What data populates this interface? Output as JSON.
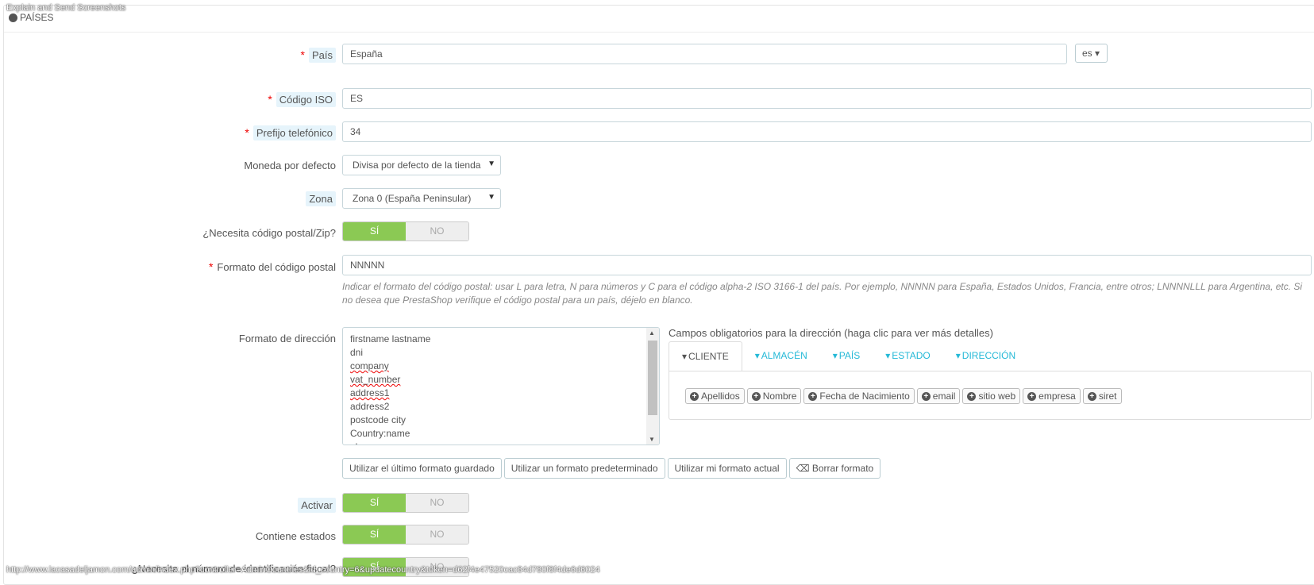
{
  "overlay_text": "Explain and Send Screenshots",
  "panel": {
    "heading": "PAÍSES"
  },
  "form": {
    "pais": {
      "label": "País",
      "value": "España",
      "lang": "es"
    },
    "iso": {
      "label": "Código ISO",
      "value": "ES"
    },
    "prefijo": {
      "label": "Prefijo telefónico",
      "value": "34"
    },
    "moneda": {
      "label": "Moneda por defecto",
      "value": "Divisa por defecto de la tienda"
    },
    "zona": {
      "label": "Zona",
      "value": "Zona 0 (España Peninsular)"
    },
    "zip_needed": {
      "label": "¿Necesita código postal/Zip?",
      "yes": "SÍ",
      "no": "NO",
      "selected": "SÍ"
    },
    "zip_format": {
      "label": "Formato del código postal",
      "value": "NNNNN",
      "help": "Indicar el formato del código postal: usar L para letra, N para números y C para el código alpha-2 ISO 3166-1 del país. Por ejemplo, NNNNN para España, Estados Unidos, Francia, entre otros; LNNNNLLL para Argentina, etc. Si no desea que PrestaShop verifique el código postal para un país, déjelo en blanco."
    },
    "address_format": {
      "label": "Formato de dirección",
      "lines": [
        "firstname lastname",
        "dni",
        "company",
        "vat_number",
        "address1",
        "address2",
        "postcode city",
        "Country:name",
        "phone"
      ]
    },
    "campos": {
      "title": "Campos obligatorios para la dirección (haga clic para ver más detalles)",
      "tabs": [
        "CLIENTE",
        "ALMACÉN",
        "PAÍS",
        "ESTADO",
        "DIRECCIÓN"
      ],
      "chips": [
        "Apellidos",
        "Nombre",
        "Fecha de Nacimiento",
        "email",
        "sitio web",
        "empresa",
        "siret"
      ]
    },
    "format_buttons": {
      "last_saved": "Utilizar el último formato guardado",
      "default": "Utilizar un formato predeterminado",
      "current": "Utilizar mi formato actual",
      "clear": "Borrar formato"
    },
    "activar": {
      "label": "Activar",
      "yes": "SÍ",
      "no": "NO"
    },
    "estados": {
      "label": "Contiene estados",
      "yes": "SÍ",
      "no": "NO"
    },
    "dni": {
      "label": "¿Necesita el número de identificación fiscal?",
      "yes": "SÍ",
      "no": "NO"
    }
  },
  "status_url": "http://www.lacasadeljamon.com/admin/index.php?controller=AdminCountries&id_country=6&updatecountry&token=d62f4e47520cac84d780f8f4de6d6024",
  "colors": {
    "toggle_on": "#8bc954",
    "link": "#25b9d7",
    "required": "#e00000"
  }
}
